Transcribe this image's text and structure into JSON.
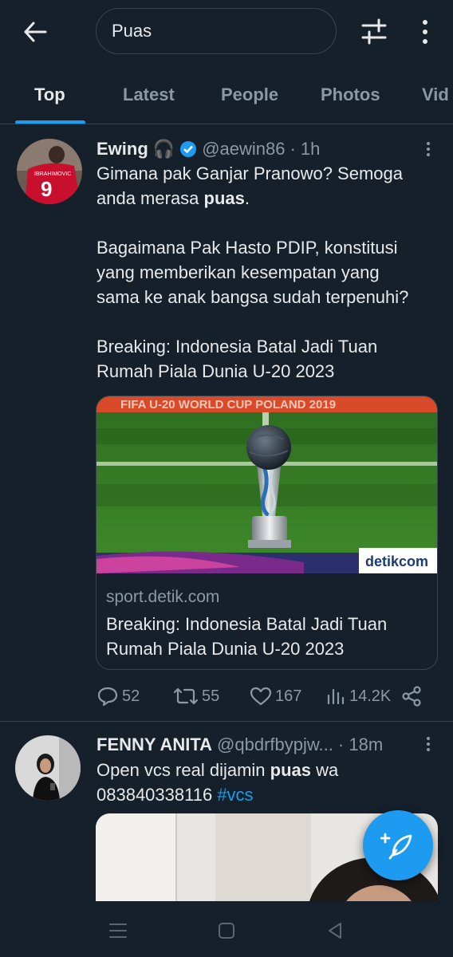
{
  "search": {
    "query": "Puas"
  },
  "icons": {
    "back": "arrow-left-icon",
    "filter": "sliders-icon",
    "more": "vertical-dots-icon",
    "fab": "compose-tweet-icon"
  },
  "tabs": [
    {
      "label": "Top",
      "active": true
    },
    {
      "label": "Latest",
      "active": false
    },
    {
      "label": "People",
      "active": false
    },
    {
      "label": "Photos",
      "active": false
    },
    {
      "label": "Vid",
      "active": false
    }
  ],
  "tweets": [
    {
      "name": "Ewing",
      "name_emoji": "🎧",
      "verified": true,
      "handle": "@aewin86",
      "time": "· 1h",
      "text_lines": [
        [
          "Gimana pak Ganjar Pranowo? Semoga"
        ],
        [
          "anda merasa ",
          {
            "b": "puas"
          },
          "."
        ],
        [
          ""
        ],
        [
          "Bagaimana Pak Hasto PDIP, konstitusi"
        ],
        [
          "yang memberikan kesempatan yang"
        ],
        [
          "sama ke anak bangsa sudah terpenuhi?"
        ],
        [
          ""
        ],
        [
          "Breaking: Indonesia Batal Jadi Tuan"
        ],
        [
          "Rumah Piala Dunia U-20 2023"
        ]
      ],
      "card": {
        "banner_text": "FIFA U-20 WORLD CUP POLAND 2019",
        "watermark": "detikcom",
        "domain": "sport.detik.com",
        "title": "Breaking: Indonesia Batal Jadi Tuan Rumah Piala Dunia U-20 2023"
      },
      "stats": {
        "replies": "52",
        "retweets": "55",
        "likes": "167",
        "views": "14.2K"
      }
    },
    {
      "name": "FENNY ANITA",
      "handle": "@qbdrfbypjw...",
      "time": "· 18m",
      "text_lines": [
        [
          "Open vcs real dijamin ",
          {
            "b": "puas"
          },
          " wa"
        ],
        [
          "083840338116 ",
          {
            "tag": "#vcs"
          }
        ]
      ]
    }
  ],
  "colors": {
    "bg": "#15202b",
    "accent": "#1d9bf0",
    "muted": "#8b98a5",
    "border": "#38444d"
  }
}
